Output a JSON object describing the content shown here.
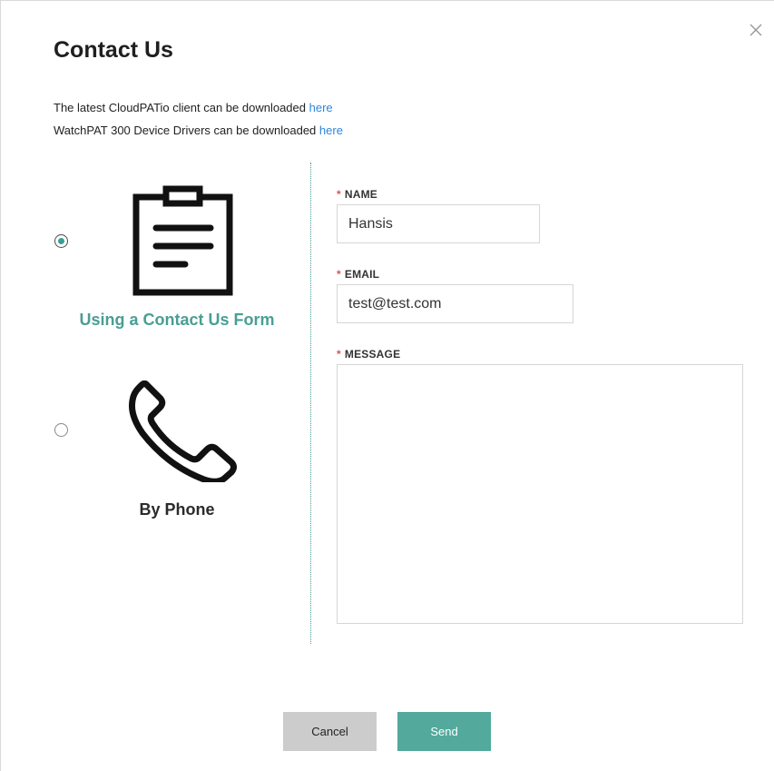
{
  "dialog": {
    "title": "Contact Us",
    "close_icon": "close-icon"
  },
  "downloads": {
    "client_text": "The latest CloudPATio client can be downloaded",
    "client_link": "here",
    "drivers_text": "WatchPAT 300 Device Drivers can be downloaded",
    "drivers_link": "here"
  },
  "options": {
    "form": {
      "label": "Using a Contact Us Form",
      "icon": "clipboard-icon",
      "selected": true
    },
    "phone": {
      "label": "By Phone",
      "icon": "phone-icon",
      "selected": false
    }
  },
  "form": {
    "required_mark": "*",
    "name_label": "NAME",
    "name_value": "Hansis",
    "email_label": "EMAIL",
    "email_value": "test@test.com",
    "message_label": "MESSAGE",
    "message_value": ""
  },
  "buttons": {
    "cancel": "Cancel",
    "send": "Send"
  },
  "colors": {
    "accent": "#52a99c",
    "link": "#2e86de",
    "required": "#d9534f"
  }
}
